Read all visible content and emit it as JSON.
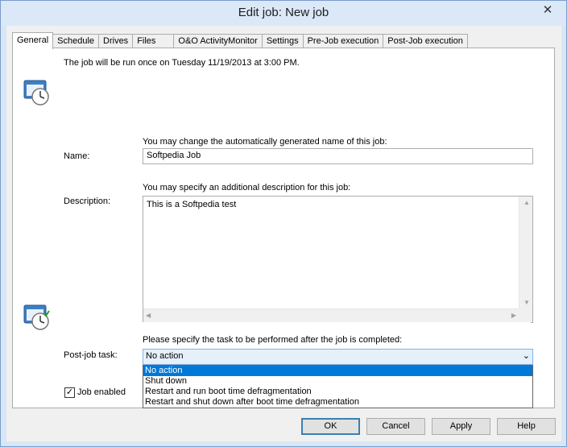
{
  "window": {
    "title": "Edit job: New job",
    "close_symbol": "✕"
  },
  "tabs": [
    {
      "label": "General",
      "active": true
    },
    {
      "label": "Schedule"
    },
    {
      "label": "Drives"
    },
    {
      "label": "Files"
    },
    {
      "label": "O&O ActivityMonitor"
    },
    {
      "label": "Settings"
    },
    {
      "label": "Pre-Job execution"
    },
    {
      "label": "Post-Job execution"
    }
  ],
  "general": {
    "schedule_info": "The job will be run once on Tuesday 11/19/2013 at 3:00 PM.",
    "name_hint": "You may change the automatically generated name of this job:",
    "name_label": "Name:",
    "name_value": "Softpedia Job",
    "description_hint": "You may specify an additional description for this job:",
    "description_label": "Description:",
    "description_value": "This is a Softpedia test",
    "post_task_hint": "Please specify the task to be performed after the job is completed:",
    "post_task_label": "Post-job task:",
    "post_task_value": "No action",
    "post_task_options": [
      "No action",
      "Shut down",
      "Restart and run boot time defragmentation",
      "Restart and shut down after boot time defragmentation"
    ],
    "post_task_selected_index": 0,
    "job_enabled_label": "Job enabled",
    "job_enabled": true
  },
  "buttons": {
    "ok": "OK",
    "cancel": "Cancel",
    "apply": "Apply",
    "help": "Help"
  },
  "icons": {
    "clock_job": "clock-window-icon",
    "clock_post": "clock-check-window-icon",
    "check": "✓",
    "chevron": "⌄",
    "up": "▲",
    "down": "▼",
    "left": "◀",
    "right": "▶"
  }
}
